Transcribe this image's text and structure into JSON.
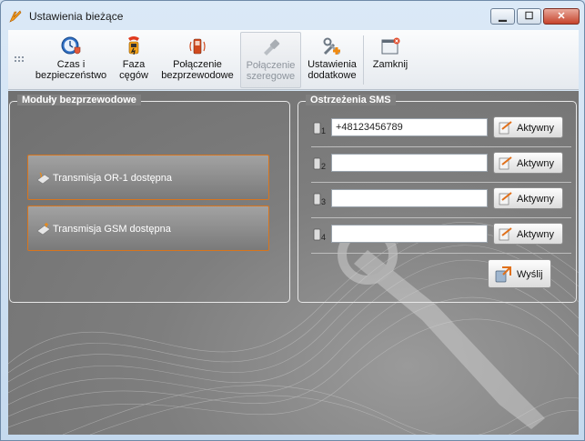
{
  "window": {
    "title": "Ustawienia bieżące",
    "minimize_glyph": "▁",
    "maximize_glyph": "☐",
    "close_glyph": "✕"
  },
  "toolbar": {
    "items": [
      {
        "line1": "Czas i",
        "line2": "bezpieczeństwo",
        "icon": "clock-shield-icon"
      },
      {
        "line1": "Faza",
        "line2": "cęgów",
        "icon": "clamp-meter-icon"
      },
      {
        "line1": "Połączenie",
        "line2": "bezprzewodowe",
        "icon": "wireless-phone-icon"
      },
      {
        "line1": "Połączenie",
        "line2": "szeregowe",
        "icon": "serial-cable-icon",
        "disabled": true
      },
      {
        "line1": "Ustawienia",
        "line2": "dodatkowe",
        "icon": "tools-plus-icon"
      },
      {
        "line1": "Zamknij",
        "line2": "",
        "icon": "close-window-icon"
      }
    ]
  },
  "modules": {
    "title": "Moduły bezprzewodowe",
    "or1_label": "Transmisja OR-1 dostępna",
    "gsm_label": "Transmisja GSM dostępna"
  },
  "sms": {
    "title": "Ostrzeżenia SMS",
    "rows": [
      {
        "index_icon": "phone-1-icon",
        "value": "+48123456789",
        "button": "Aktywny"
      },
      {
        "index_icon": "phone-2-icon",
        "value": "",
        "button": "Aktywny"
      },
      {
        "index_icon": "phone-3-icon",
        "value": "",
        "button": "Aktywny"
      },
      {
        "index_icon": "phone-4-icon",
        "value": "",
        "button": "Aktywny"
      }
    ],
    "send_label": "Wyślij"
  },
  "colors": {
    "accent_orange": "#d8751d",
    "panel_gray": "#7f7f7f"
  }
}
